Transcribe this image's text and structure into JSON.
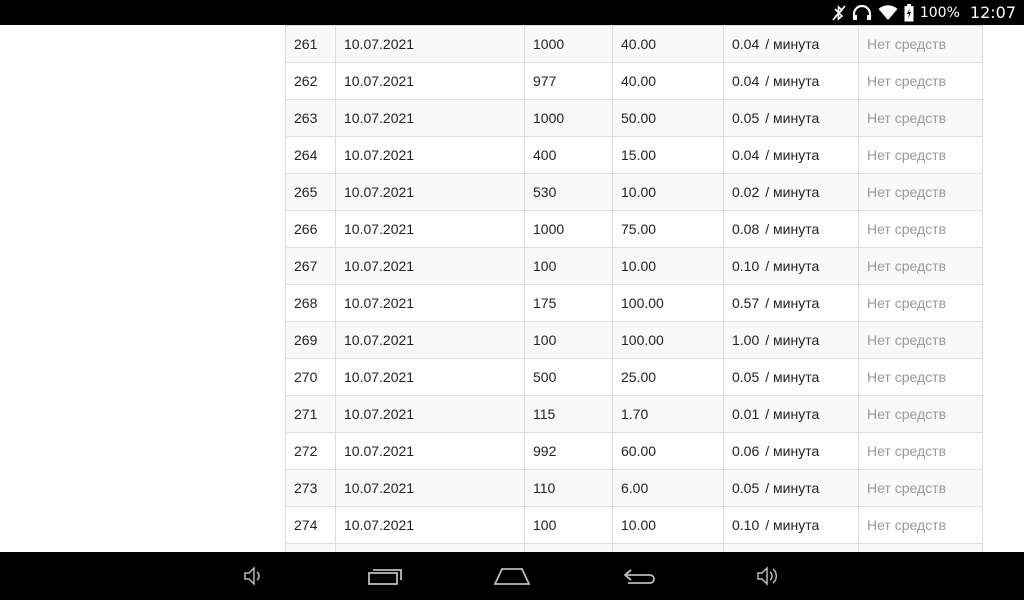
{
  "status_bar": {
    "battery": "100%",
    "time": "12:07"
  },
  "table": {
    "rows": [
      {
        "id": "261",
        "date": "10.07.2021",
        "qty": "1000",
        "amount": "40.00",
        "rate": "0.04",
        "unit": "/ минута",
        "status": "Нет средств"
      },
      {
        "id": "262",
        "date": "10.07.2021",
        "qty": "977",
        "amount": "40.00",
        "rate": "0.04",
        "unit": "/ минута",
        "status": "Нет средств"
      },
      {
        "id": "263",
        "date": "10.07.2021",
        "qty": "1000",
        "amount": "50.00",
        "rate": "0.05",
        "unit": "/ минута",
        "status": "Нет средств"
      },
      {
        "id": "264",
        "date": "10.07.2021",
        "qty": "400",
        "amount": "15.00",
        "rate": "0.04",
        "unit": "/ минута",
        "status": "Нет средств"
      },
      {
        "id": "265",
        "date": "10.07.2021",
        "qty": "530",
        "amount": "10.00",
        "rate": "0.02",
        "unit": "/ минута",
        "status": "Нет средств"
      },
      {
        "id": "266",
        "date": "10.07.2021",
        "qty": "1000",
        "amount": "75.00",
        "rate": "0.08",
        "unit": "/ минута",
        "status": "Нет средств"
      },
      {
        "id": "267",
        "date": "10.07.2021",
        "qty": "100",
        "amount": "10.00",
        "rate": "0.10",
        "unit": "/ минута",
        "status": "Нет средств"
      },
      {
        "id": "268",
        "date": "10.07.2021",
        "qty": "175",
        "amount": "100.00",
        "rate": "0.57",
        "unit": "/ минута",
        "status": "Нет средств"
      },
      {
        "id": "269",
        "date": "10.07.2021",
        "qty": "100",
        "amount": "100.00",
        "rate": "1.00",
        "unit": "/ минута",
        "status": "Нет средств"
      },
      {
        "id": "270",
        "date": "10.07.2021",
        "qty": "500",
        "amount": "25.00",
        "rate": "0.05",
        "unit": "/ минута",
        "status": "Нет средств"
      },
      {
        "id": "271",
        "date": "10.07.2021",
        "qty": "115",
        "amount": "1.70",
        "rate": "0.01",
        "unit": "/ минута",
        "status": "Нет средств"
      },
      {
        "id": "272",
        "date": "10.07.2021",
        "qty": "992",
        "amount": "60.00",
        "rate": "0.06",
        "unit": "/ минута",
        "status": "Нет средств"
      },
      {
        "id": "273",
        "date": "10.07.2021",
        "qty": "110",
        "amount": "6.00",
        "rate": "0.05",
        "unit": "/ минута",
        "status": "Нет средств"
      },
      {
        "id": "274",
        "date": "10.07.2021",
        "qty": "100",
        "amount": "10.00",
        "rate": "0.10",
        "unit": "/ минута",
        "status": "Нет средств"
      }
    ]
  },
  "icons": {
    "status": [
      "bluetooth-off-icon",
      "headset-icon",
      "wifi-icon",
      "battery-charging-icon"
    ],
    "nav": [
      "volume-down-icon",
      "recent-apps-icon",
      "home-icon",
      "back-icon",
      "volume-up-icon"
    ]
  },
  "colors": {
    "bar_background": "#000000",
    "status_text_muted": "#999999",
    "row_stripe": "#f9f9f9",
    "border": "#dddddd"
  }
}
